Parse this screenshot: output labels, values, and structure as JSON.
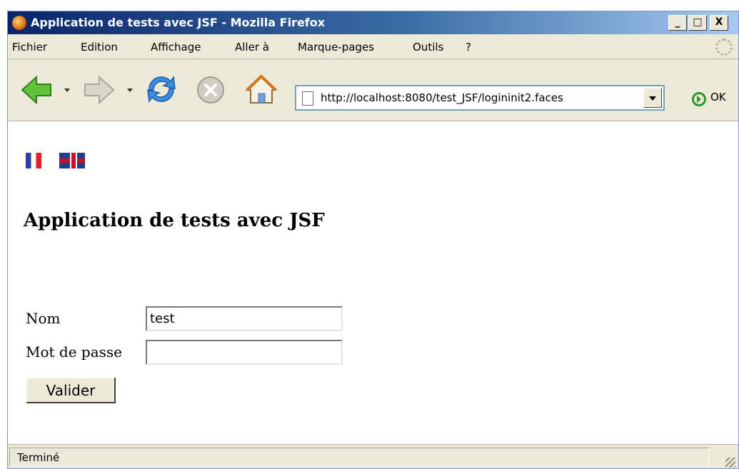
{
  "window": {
    "title": "Application de tests avec JSF - Mozilla Firefox",
    "controls": [
      "_",
      "□",
      "X"
    ]
  },
  "menu": {
    "items": [
      {
        "label": "Fichier"
      },
      {
        "label": "Edition"
      },
      {
        "label": "Affichage"
      },
      {
        "label": "Aller à"
      },
      {
        "label": "Marque-pages"
      },
      {
        "label": "Outils"
      },
      {
        "label": "?"
      }
    ]
  },
  "toolbar": {
    "url": "http://localhost:8080/test_JSF/logininit2.faces",
    "ok_label": "OK",
    "icons": [
      "back-arrow-icon",
      "forward-arrow-icon",
      "reload-icon",
      "stop-icon",
      "home-icon"
    ]
  },
  "page": {
    "flags": [
      "french-flag",
      "uk-flag"
    ],
    "heading": "Application de tests avec JSF",
    "form": {
      "name_label": "Nom",
      "name_value": "test",
      "password_label": "Mot de passe",
      "password_value": "",
      "submit_label": "Valider"
    }
  },
  "status": {
    "text": "Terminé"
  },
  "colors": {
    "titlebar_start": "#0a246a",
    "titlebar_end": "#a6caf0",
    "chrome": "#ece9d8",
    "content_bg": "#ffffff"
  }
}
